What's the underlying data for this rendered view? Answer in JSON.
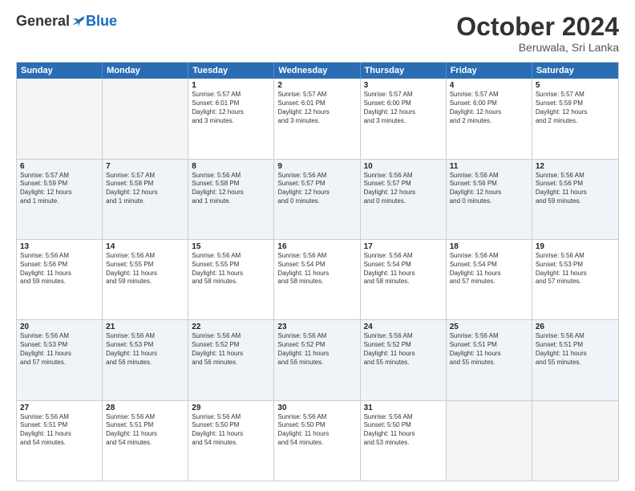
{
  "logo": {
    "general": "General",
    "blue": "Blue"
  },
  "title": "October 2024",
  "subtitle": "Beruwala, Sri Lanka",
  "header_days": [
    "Sunday",
    "Monday",
    "Tuesday",
    "Wednesday",
    "Thursday",
    "Friday",
    "Saturday"
  ],
  "rows": [
    [
      {
        "day": "",
        "lines": [],
        "empty": true
      },
      {
        "day": "",
        "lines": [],
        "empty": true
      },
      {
        "day": "1",
        "lines": [
          "Sunrise: 5:57 AM",
          "Sunset: 6:01 PM",
          "Daylight: 12 hours",
          "and 3 minutes."
        ]
      },
      {
        "day": "2",
        "lines": [
          "Sunrise: 5:57 AM",
          "Sunset: 6:01 PM",
          "Daylight: 12 hours",
          "and 3 minutes."
        ]
      },
      {
        "day": "3",
        "lines": [
          "Sunrise: 5:57 AM",
          "Sunset: 6:00 PM",
          "Daylight: 12 hours",
          "and 3 minutes."
        ]
      },
      {
        "day": "4",
        "lines": [
          "Sunrise: 5:57 AM",
          "Sunset: 6:00 PM",
          "Daylight: 12 hours",
          "and 2 minutes."
        ]
      },
      {
        "day": "5",
        "lines": [
          "Sunrise: 5:57 AM",
          "Sunset: 5:59 PM",
          "Daylight: 12 hours",
          "and 2 minutes."
        ]
      }
    ],
    [
      {
        "day": "6",
        "lines": [
          "Sunrise: 5:57 AM",
          "Sunset: 5:59 PM",
          "Daylight: 12 hours",
          "and 1 minute."
        ]
      },
      {
        "day": "7",
        "lines": [
          "Sunrise: 5:57 AM",
          "Sunset: 5:58 PM",
          "Daylight: 12 hours",
          "and 1 minute."
        ]
      },
      {
        "day": "8",
        "lines": [
          "Sunrise: 5:56 AM",
          "Sunset: 5:58 PM",
          "Daylight: 12 hours",
          "and 1 minute."
        ]
      },
      {
        "day": "9",
        "lines": [
          "Sunrise: 5:56 AM",
          "Sunset: 5:57 PM",
          "Daylight: 12 hours",
          "and 0 minutes."
        ]
      },
      {
        "day": "10",
        "lines": [
          "Sunrise: 5:56 AM",
          "Sunset: 5:57 PM",
          "Daylight: 12 hours",
          "and 0 minutes."
        ]
      },
      {
        "day": "11",
        "lines": [
          "Sunrise: 5:56 AM",
          "Sunset: 5:56 PM",
          "Daylight: 12 hours",
          "and 0 minutes."
        ]
      },
      {
        "day": "12",
        "lines": [
          "Sunrise: 5:56 AM",
          "Sunset: 5:56 PM",
          "Daylight: 11 hours",
          "and 59 minutes."
        ]
      }
    ],
    [
      {
        "day": "13",
        "lines": [
          "Sunrise: 5:56 AM",
          "Sunset: 5:56 PM",
          "Daylight: 11 hours",
          "and 59 minutes."
        ]
      },
      {
        "day": "14",
        "lines": [
          "Sunrise: 5:56 AM",
          "Sunset: 5:55 PM",
          "Daylight: 11 hours",
          "and 59 minutes."
        ]
      },
      {
        "day": "15",
        "lines": [
          "Sunrise: 5:56 AM",
          "Sunset: 5:55 PM",
          "Daylight: 11 hours",
          "and 58 minutes."
        ]
      },
      {
        "day": "16",
        "lines": [
          "Sunrise: 5:56 AM",
          "Sunset: 5:54 PM",
          "Daylight: 11 hours",
          "and 58 minutes."
        ]
      },
      {
        "day": "17",
        "lines": [
          "Sunrise: 5:56 AM",
          "Sunset: 5:54 PM",
          "Daylight: 11 hours",
          "and 58 minutes."
        ]
      },
      {
        "day": "18",
        "lines": [
          "Sunrise: 5:56 AM",
          "Sunset: 5:54 PM",
          "Daylight: 11 hours",
          "and 57 minutes."
        ]
      },
      {
        "day": "19",
        "lines": [
          "Sunrise: 5:56 AM",
          "Sunset: 5:53 PM",
          "Daylight: 11 hours",
          "and 57 minutes."
        ]
      }
    ],
    [
      {
        "day": "20",
        "lines": [
          "Sunrise: 5:56 AM",
          "Sunset: 5:53 PM",
          "Daylight: 11 hours",
          "and 57 minutes."
        ]
      },
      {
        "day": "21",
        "lines": [
          "Sunrise: 5:56 AM",
          "Sunset: 5:53 PM",
          "Daylight: 11 hours",
          "and 56 minutes."
        ]
      },
      {
        "day": "22",
        "lines": [
          "Sunrise: 5:56 AM",
          "Sunset: 5:52 PM",
          "Daylight: 11 hours",
          "and 56 minutes."
        ]
      },
      {
        "day": "23",
        "lines": [
          "Sunrise: 5:56 AM",
          "Sunset: 5:52 PM",
          "Daylight: 11 hours",
          "and 56 minutes."
        ]
      },
      {
        "day": "24",
        "lines": [
          "Sunrise: 5:56 AM",
          "Sunset: 5:52 PM",
          "Daylight: 11 hours",
          "and 55 minutes."
        ]
      },
      {
        "day": "25",
        "lines": [
          "Sunrise: 5:56 AM",
          "Sunset: 5:51 PM",
          "Daylight: 11 hours",
          "and 55 minutes."
        ]
      },
      {
        "day": "26",
        "lines": [
          "Sunrise: 5:56 AM",
          "Sunset: 5:51 PM",
          "Daylight: 11 hours",
          "and 55 minutes."
        ]
      }
    ],
    [
      {
        "day": "27",
        "lines": [
          "Sunrise: 5:56 AM",
          "Sunset: 5:51 PM",
          "Daylight: 11 hours",
          "and 54 minutes."
        ]
      },
      {
        "day": "28",
        "lines": [
          "Sunrise: 5:56 AM",
          "Sunset: 5:51 PM",
          "Daylight: 11 hours",
          "and 54 minutes."
        ]
      },
      {
        "day": "29",
        "lines": [
          "Sunrise: 5:56 AM",
          "Sunset: 5:50 PM",
          "Daylight: 11 hours",
          "and 54 minutes."
        ]
      },
      {
        "day": "30",
        "lines": [
          "Sunrise: 5:56 AM",
          "Sunset: 5:50 PM",
          "Daylight: 11 hours",
          "and 54 minutes."
        ]
      },
      {
        "day": "31",
        "lines": [
          "Sunrise: 5:56 AM",
          "Sunset: 5:50 PM",
          "Daylight: 11 hours",
          "and 53 minutes."
        ]
      },
      {
        "day": "",
        "lines": [],
        "empty": true
      },
      {
        "day": "",
        "lines": [],
        "empty": true
      }
    ]
  ]
}
